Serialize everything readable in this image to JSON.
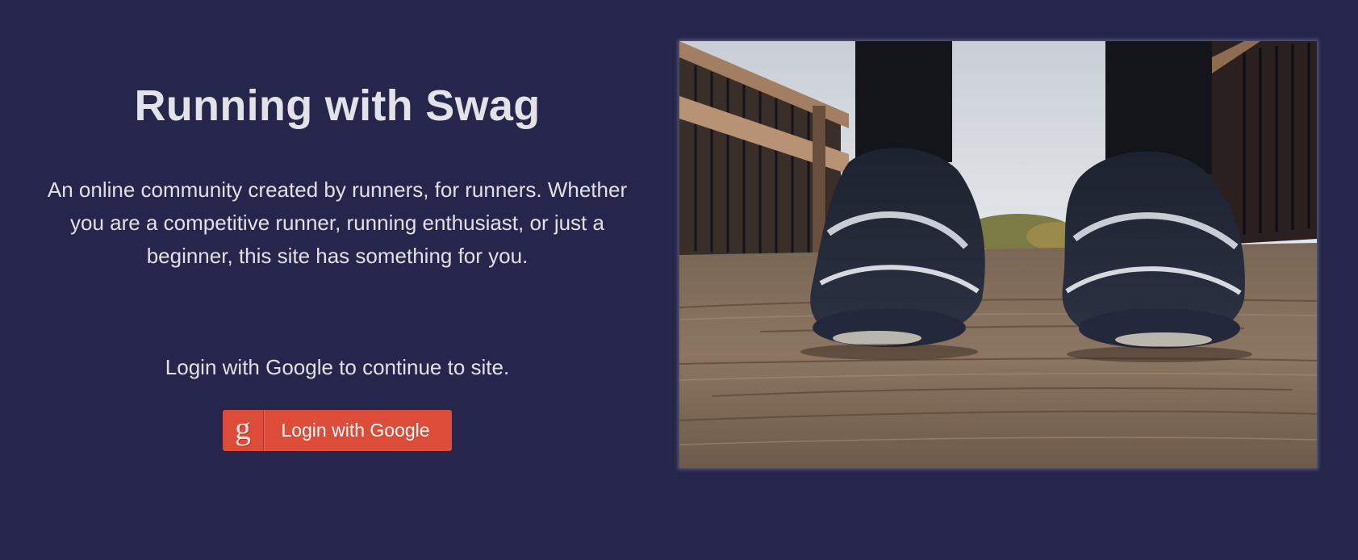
{
  "hero": {
    "title": "Running with Swag",
    "description": "An online community created by runners, for runners. Whether you are a competitive runner, running enthusiast, or just a beginner, this site has something for you.",
    "login_prompt": "Login with Google to continue to site.",
    "login_button": {
      "icon": "google-icon",
      "icon_glyph": "g",
      "label": "Login with Google",
      "color": "#dd4b39"
    }
  },
  "colors": {
    "background": "#26264c",
    "text": "#e0e0e6"
  },
  "photo": {
    "subject": "running-shoes-photo"
  }
}
